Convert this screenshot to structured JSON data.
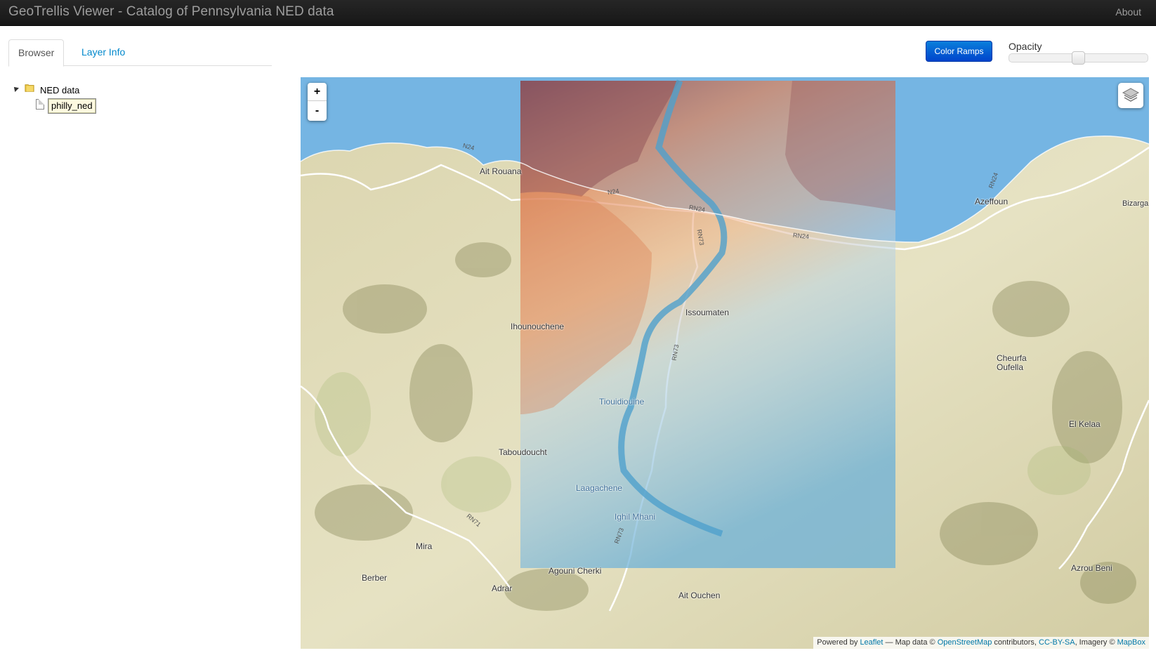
{
  "navbar": {
    "title": "GeoTrellis Viewer - Catalog of Pennsylvania NED data",
    "about": "About"
  },
  "tabs": [
    {
      "label": "Browser",
      "active": true
    },
    {
      "label": "Layer Info",
      "active": false
    }
  ],
  "tree": {
    "root": {
      "label": "NED data",
      "icon": "folder-icon"
    },
    "child": {
      "label": "philly_ned",
      "icon": "file-icon",
      "selected": true
    }
  },
  "controls": {
    "color_ramps": "Color Ramps",
    "opacity_label": "Opacity",
    "opacity_value": 0.5
  },
  "map": {
    "zoom_in": "+",
    "zoom_out": "-",
    "places": [
      {
        "name": "Ait Rouana"
      },
      {
        "name": "Azeffoun"
      },
      {
        "name": "Bizarga"
      },
      {
        "name": "Issoumaten"
      },
      {
        "name": "Ihounouchene"
      },
      {
        "name": "Cheurfa"
      },
      {
        "name": "Oufella"
      },
      {
        "name": "Tiouidiouine"
      },
      {
        "name": "El Kelaa"
      },
      {
        "name": "Taboudoucht"
      },
      {
        "name": "Laagachene"
      },
      {
        "name": "Ighil Mhani"
      },
      {
        "name": "Mira"
      },
      {
        "name": "Berber"
      },
      {
        "name": "Agouni Cherki"
      },
      {
        "name": "Adrar"
      },
      {
        "name": "Ait Ouchen"
      },
      {
        "name": "Azrou Beni"
      }
    ],
    "roads": [
      "N24",
      "N24",
      "RN24",
      "RN24",
      "RN73",
      "RN73",
      "RN24",
      "RN71",
      "RN73"
    ],
    "attribution": {
      "powered_by": "Powered by",
      "leaflet": "Leaflet",
      "map_data": "— Map data ©",
      "osm": "OpenStreetMap",
      "contributors": "contributors,",
      "license": "CC-BY-SA",
      "imagery": ", Imagery ©",
      "mapbox": "MapBox"
    },
    "colors": {
      "sea": "#75b5e3",
      "land": "#e2dfbf",
      "overlay_high": "#8a4a52",
      "overlay_mid": "#e0835a",
      "overlay_low": "#6ab0d8"
    }
  }
}
